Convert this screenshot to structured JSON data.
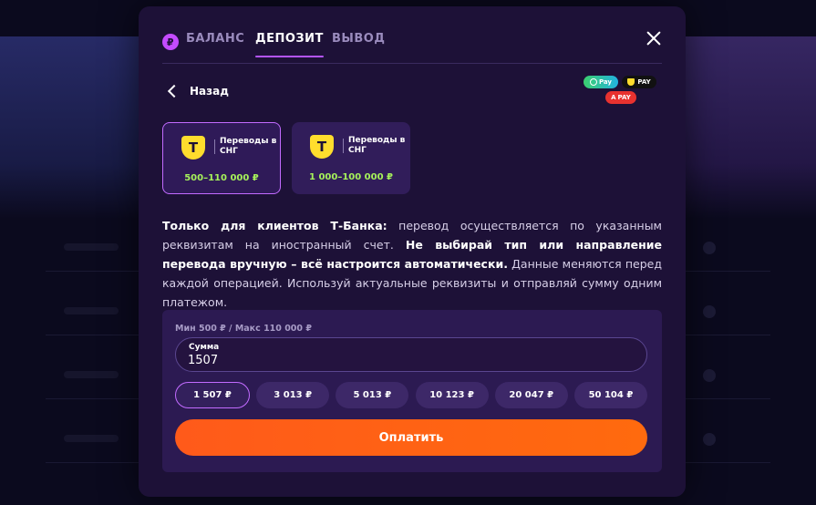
{
  "tabs": {
    "balance": "БАЛАНС",
    "deposit": "ДЕПОЗИТ",
    "withdraw": "ВЫВОД",
    "active": "deposit"
  },
  "back_label": "Назад",
  "pay_badges": {
    "sbp": "Pay",
    "tpay": "PAY",
    "apay": "PAY"
  },
  "methods": [
    {
      "logo": "T",
      "label": "Переводы в СНГ",
      "range": "500–110 000 ₽",
      "selected": true
    },
    {
      "logo": "T",
      "label": "Переводы в СНГ",
      "range": "1 000–100 000 ₽",
      "selected": false
    }
  ],
  "description": {
    "part1_bold": "Только для клиентов Т-Банка:",
    "part2": " перевод осуществляется по указанным реквизитам на иностранный счет. ",
    "part3_bold": "Не выбирай тип или направление перевода вручную – всё настроится автоматически.",
    "part4": " Данные меняются перед каждой операцией. Используй актуальные реквизиты и отправляй сумму одним платежом."
  },
  "form": {
    "limits": "Мин 500 ₽ / Макс 110 000 ₽",
    "amount_label": "Сумма",
    "amount_value": "1507",
    "presets": [
      "1 507 ₽",
      "3 013 ₽",
      "5 013 ₽",
      "10 123 ₽",
      "20 047 ₽",
      "50 104 ₽"
    ],
    "active_preset": 0,
    "pay_button": "Оплатить"
  },
  "colors": {
    "accent": "#c26bff",
    "pay_button": "#ff5a1a",
    "range_text": "#a6f25a",
    "tbank_yellow": "#ffdd2d"
  }
}
